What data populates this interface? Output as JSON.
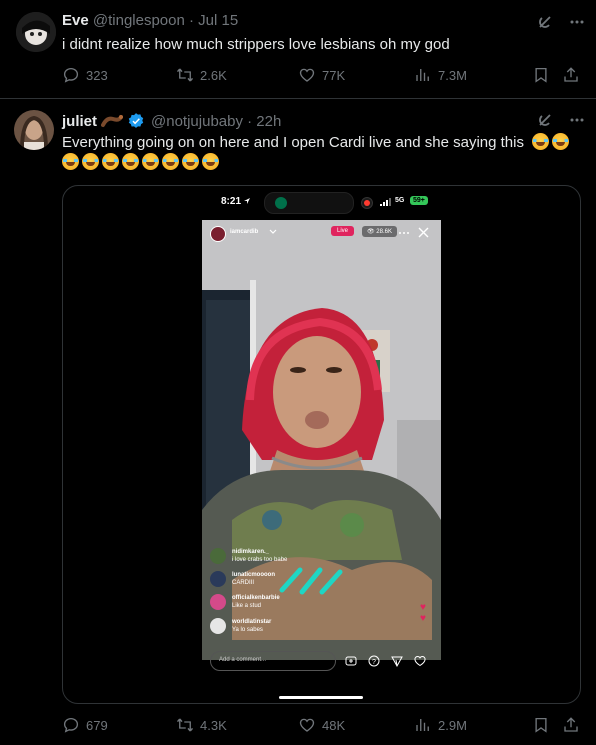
{
  "tweet1": {
    "name": "Eve",
    "handle": "@tinglespoon · Jul 15",
    "text": "i didnt realize how much strippers love lesbians oh my god",
    "replies": "323",
    "retweets": "2.6K",
    "likes": "77K",
    "views": "7.3M"
  },
  "tweet2": {
    "name": "juliet",
    "handle": "@notjujubaby · 22h",
    "text": "Everything going on on here and I open Cardi live and she saying this",
    "replies": "679",
    "retweets": "4.3K",
    "likes": "48K",
    "views": "2.9M",
    "verified_color": "#1d9bf0"
  },
  "video": {
    "time": "8:21",
    "network": "5G",
    "battery": "59+",
    "username": "iamcardib",
    "live_badge": "Live",
    "viewers": "28.6K",
    "comment_placeholder": "Add a comment...",
    "comments": [
      {
        "user": "nidimkaren._",
        "text": "i love crabs too babe"
      },
      {
        "user": "lunaticmoooon",
        "text": "CARDIII"
      },
      {
        "user": "officialkenbarbie",
        "text": "Like a stud"
      },
      {
        "user": "worldlatinstar",
        "text": "Ya lo sabes"
      }
    ]
  },
  "colors": {
    "background": "#000000",
    "text": "#e7e9ea",
    "muted": "#71767b",
    "live": "#e0245e"
  }
}
